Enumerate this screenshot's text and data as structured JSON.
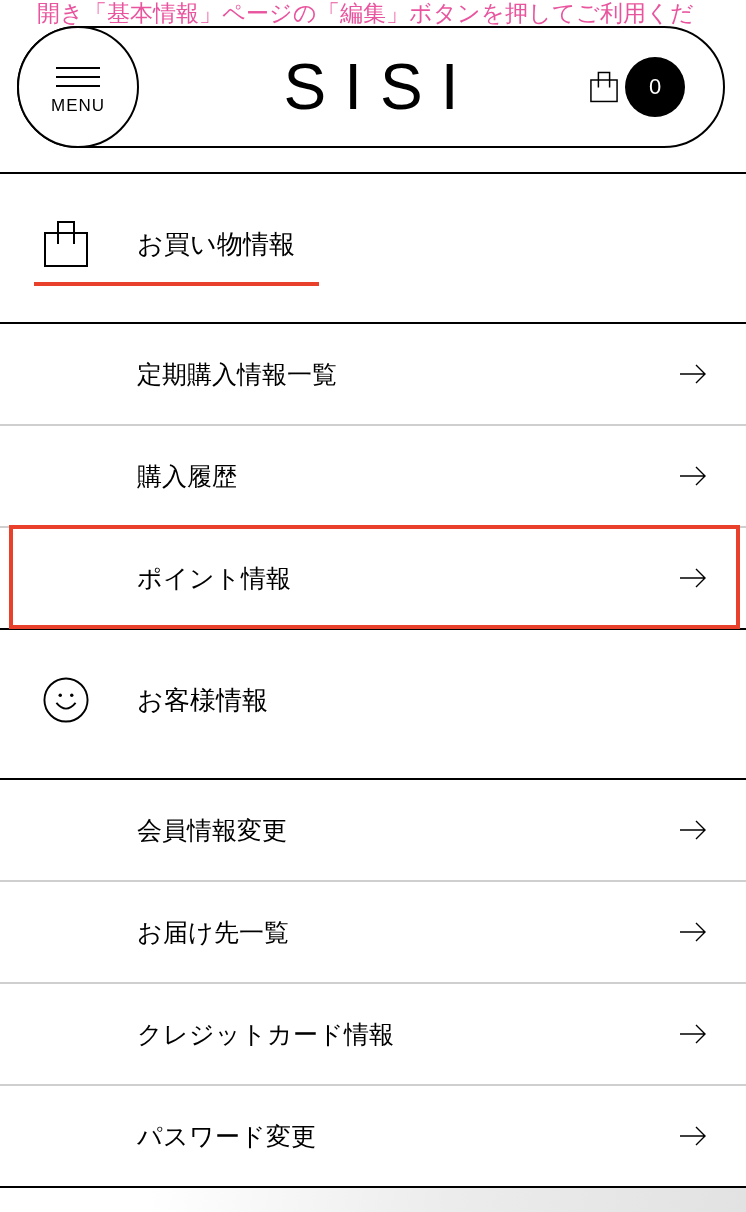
{
  "notice": {
    "text": "開き「基本情報」ページの「編集」ボタンを押してご利用くだ"
  },
  "header": {
    "menu_label": "MENU",
    "logo": "SISI",
    "cart_count": "0"
  },
  "sections": [
    {
      "kind": "shopping",
      "title": "お買い物情報",
      "selected": true,
      "items": [
        {
          "label": "定期購入情報一覧",
          "highlighted": false
        },
        {
          "label": "購入履歴",
          "highlighted": false
        },
        {
          "label": "ポイント情報",
          "highlighted": true
        }
      ]
    },
    {
      "kind": "customer",
      "title": "お客様情報",
      "selected": false,
      "items": [
        {
          "label": "会員情報変更",
          "highlighted": false
        },
        {
          "label": "お届け先一覧",
          "highlighted": false
        },
        {
          "label": "クレジットカード情報",
          "highlighted": false
        },
        {
          "label": "パスワード変更",
          "highlighted": false
        }
      ]
    }
  ]
}
